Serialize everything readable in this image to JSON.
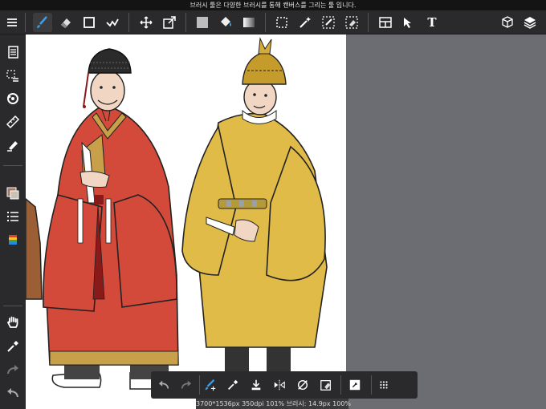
{
  "tip": {
    "text": "브러시 툴은 다양한 브러시를 통해 캔버스를 그리는 툴 입니다."
  },
  "toolbar": {
    "items": [
      {
        "icon": "menu-icon"
      },
      {
        "icon": "brush-icon"
      },
      {
        "icon": "eraser-icon"
      },
      {
        "icon": "rectangle-icon"
      },
      {
        "icon": "correction-icon"
      },
      {
        "icon": "move-icon"
      },
      {
        "icon": "transform-icon"
      },
      {
        "icon": "fill-color-icon"
      },
      {
        "icon": "bucket-icon"
      },
      {
        "icon": "gradient-icon"
      },
      {
        "icon": "select-icon"
      },
      {
        "icon": "magic-wand-icon"
      },
      {
        "icon": "select-pen-icon"
      },
      {
        "icon": "select-eraser-icon"
      },
      {
        "icon": "frame-divider-icon"
      },
      {
        "icon": "operation-icon"
      },
      {
        "icon": "text-icon"
      },
      {
        "icon": "material-icon"
      },
      {
        "icon": "layers-icon"
      }
    ],
    "text_tool_label": "T"
  },
  "sidebar": {
    "items": [
      {
        "icon": "pages-icon"
      },
      {
        "icon": "selection-list-icon"
      },
      {
        "icon": "rotate-icon"
      },
      {
        "icon": "ruler-icon"
      },
      {
        "icon": "snap-pen-icon"
      },
      {
        "icon": "color-swatch-icon"
      },
      {
        "icon": "brush-list-icon"
      },
      {
        "icon": "palette-icon"
      },
      {
        "icon": "hand-icon"
      },
      {
        "icon": "eyedropper-icon"
      },
      {
        "icon": "redo-icon"
      },
      {
        "icon": "undo-icon"
      }
    ]
  },
  "bottombar": {
    "items": [
      {
        "icon": "undo-icon"
      },
      {
        "icon": "redo-icon"
      },
      {
        "icon": "brush-size-icon"
      },
      {
        "icon": "eyedropper-icon"
      },
      {
        "icon": "save-icon"
      },
      {
        "icon": "flip-icon"
      },
      {
        "icon": "rotate-reset-icon"
      },
      {
        "icon": "clear-icon"
      },
      {
        "icon": "layer-icon"
      },
      {
        "icon": "more-icon"
      }
    ]
  },
  "status": {
    "text": "3700*1536px 350dpi 101% 브러시: 14.9px 100%"
  },
  "colors": {
    "toolbar_bg": "#2a2a2c",
    "canvas_bg": "#ffffff",
    "workspace_bg": "#6b6d72",
    "accent_blue": "#3aa0e8",
    "robe_red": "#d44a3a",
    "robe_yellow": "#e0bb48",
    "trim_gold": "#c8a04a"
  }
}
